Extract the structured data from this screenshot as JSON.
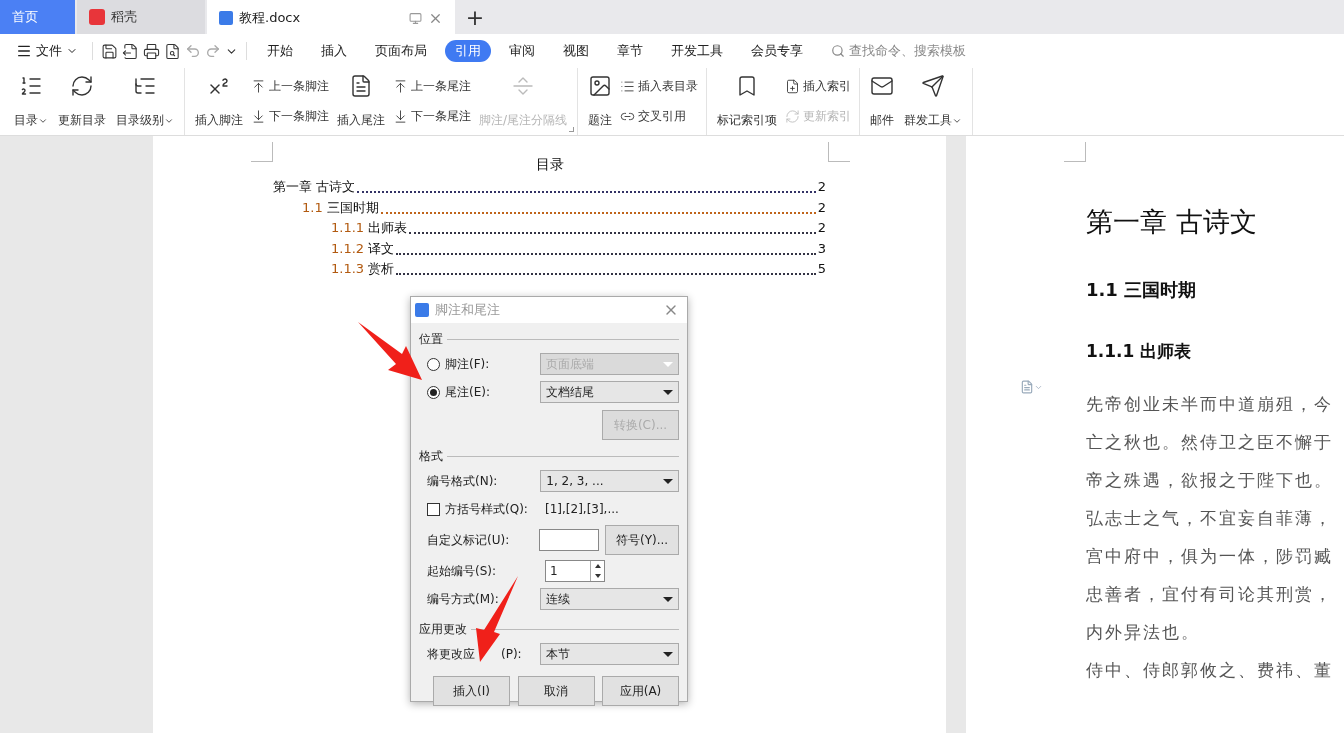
{
  "tabs": [
    {
      "label": "首页",
      "kind": "home",
      "selected": false
    },
    {
      "label": "稻壳",
      "kind": "docer",
      "selected": false
    },
    {
      "label": "教程.docx",
      "kind": "doc",
      "selected": true
    }
  ],
  "new_tab": "+",
  "menu": {
    "file": "文件",
    "tabs": [
      {
        "label": "开始",
        "selected": false
      },
      {
        "label": "插入",
        "selected": false
      },
      {
        "label": "页面布局",
        "selected": false
      },
      {
        "label": "引用",
        "selected": true
      },
      {
        "label": "审阅",
        "selected": false
      },
      {
        "label": "视图",
        "selected": false
      },
      {
        "label": "章节",
        "selected": false
      },
      {
        "label": "开发工具",
        "selected": false
      },
      {
        "label": "会员专享",
        "selected": false
      }
    ],
    "search": {
      "placeholder": "查找命令、搜索模板"
    }
  },
  "ribbon": [
    {
      "items": [
        {
          "kind": "large",
          "label": "目录",
          "dropdown": true,
          "disabled": false
        },
        {
          "kind": "large",
          "label": "更新目录",
          "dropdown": false,
          "disabled": false
        },
        {
          "kind": "large",
          "label": "目录级别",
          "dropdown": true,
          "disabled": false
        }
      ]
    },
    {
      "launcher": true,
      "items": [
        {
          "kind": "large",
          "label": "插入脚注",
          "dropdown": false,
          "disabled": false
        },
        {
          "kind": "stack",
          "items": [
            {
              "label": "上一条脚注",
              "disabled": false
            },
            {
              "label": "下一条脚注",
              "disabled": false
            }
          ]
        },
        {
          "kind": "large",
          "label": "插入尾注",
          "dropdown": false,
          "disabled": false
        },
        {
          "kind": "stack",
          "items": [
            {
              "label": "上一条尾注",
              "disabled": false
            },
            {
              "label": "下一条尾注",
              "disabled": false
            }
          ]
        },
        {
          "kind": "large",
          "label": "脚注/尾注分隔线",
          "dropdown": false,
          "disabled": true
        }
      ]
    },
    {
      "items": [
        {
          "kind": "large",
          "label": "题注",
          "dropdown": false,
          "disabled": false
        },
        {
          "kind": "stack",
          "items": [
            {
              "label": "插入表目录",
              "disabled": false
            },
            {
              "label": "交叉引用",
              "disabled": false
            }
          ]
        }
      ]
    },
    {
      "items": [
        {
          "kind": "large",
          "label": "标记索引项",
          "dropdown": false,
          "disabled": false
        },
        {
          "kind": "stack",
          "items": [
            {
              "label": "插入索引",
              "disabled": false
            },
            {
              "label": "更新索引",
              "disabled": true
            }
          ]
        }
      ]
    },
    {
      "items": [
        {
          "kind": "large",
          "label": "邮件",
          "dropdown": false,
          "disabled": false
        },
        {
          "kind": "large",
          "label": "群发工具",
          "dropdown": true,
          "disabled": false
        }
      ]
    }
  ],
  "toc": {
    "title": "目录",
    "entries": [
      {
        "number": "第一章",
        "title": "古诗文",
        "page": "2",
        "children": [
          {
            "number": "1.1",
            "title": "三国时期",
            "page": "2",
            "children": [
              {
                "number": "1.1.1",
                "title": "出师表",
                "page": "2"
              },
              {
                "number": "1.1.2",
                "title": "译文",
                "page": "3"
              },
              {
                "number": "1.1.3",
                "title": "赏析",
                "page": "5"
              }
            ]
          }
        ]
      }
    ]
  },
  "page2": {
    "chapter": "第一章  古诗文",
    "section": "1.1  三国时期",
    "subsection": "1.1.1  出师表",
    "paragraphs": [
      "先帝创业未半而中道崩殂，今",
      "亡之秋也。然侍卫之臣不懈于",
      "帝之殊遇，欲报之于陛下也。",
      "弘志士之气，不宜妄自菲薄，",
      "宫中府中，俱为一体，陟罚臧",
      "忠善者，宜付有司论其刑赏，",
      "内外异法也。",
      "侍中、侍郎郭攸之、费祎、董"
    ]
  },
  "dialog": {
    "title": "脚注和尾注",
    "position": {
      "heading": "位置",
      "options": [
        {
          "label": "脚注(F):",
          "selected": false,
          "value": "页面底端"
        },
        {
          "label": "尾注(E):",
          "selected": true,
          "value": "文档结尾"
        }
      ],
      "convert": {
        "label": "转换(C)...",
        "disabled": true
      }
    },
    "format": {
      "heading": "格式",
      "number_format": {
        "label": "编号格式(N):",
        "value": "1, 2, 3, ..."
      },
      "bracket": {
        "label": "方括号样式(Q):",
        "checked": false,
        "sample": "[1],[2],[3],..."
      },
      "custom_mark": {
        "label": "自定义标记(U):",
        "symbol_button": "符号(Y)..."
      },
      "start": {
        "label": "起始编号(S):",
        "value": "1"
      },
      "numbering": {
        "label": "编号方式(M):",
        "value": "连续"
      }
    },
    "apply": {
      "heading": "应用更改",
      "label_start": "将更改应",
      "label_end": "(P):",
      "value": "本节"
    },
    "buttons": [
      "插入(I)",
      "取消",
      "应用(A)"
    ]
  },
  "annotations": [
    {
      "kind": "arrow"
    },
    {
      "kind": "arrow"
    }
  ]
}
